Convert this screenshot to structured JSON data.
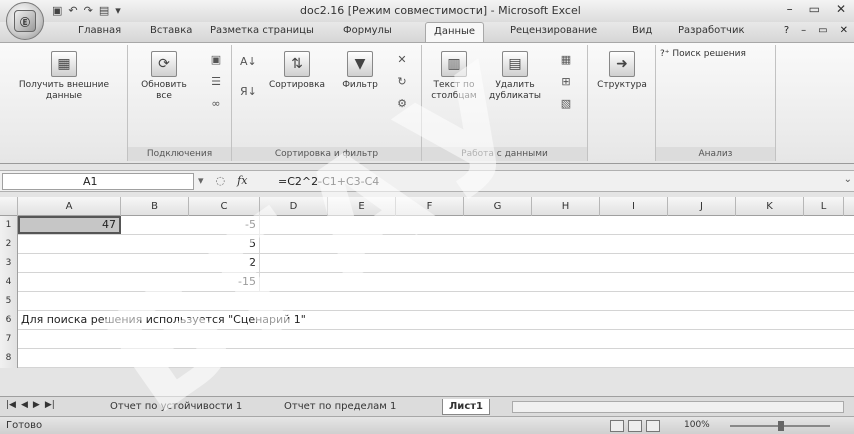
{
  "window": {
    "title": "doc2.16 [Режим совместимости] - Microsoft Excel",
    "office_logo": "Ⓔ"
  },
  "ribbon_tabs": [
    "Главная",
    "Вставка",
    "Разметка страницы",
    "Формулы",
    "Данные",
    "Рецензирование",
    "Вид",
    "Разработчик"
  ],
  "active_tab": "Данные",
  "ribbon": {
    "get_external": "Получить внешние данные",
    "refresh_all": "Обновить все",
    "group_connections": "Подключения",
    "sort": "Сортировка",
    "filter": "Фильтр",
    "group_sort_filter": "Сортировка и фильтр",
    "text_to_columns": "Текст по столбцам",
    "remove_duplicates": "Удалить дубликаты",
    "group_data_tools": "Работа с данными",
    "outline": "Структура",
    "solver": "Поиск решения",
    "group_analysis": "Анализ"
  },
  "formula_bar": {
    "name_box": "A1",
    "fx": "fx",
    "formula": "=C2^2-C1+C3-C4"
  },
  "columns": [
    "A",
    "B",
    "C",
    "D",
    "E",
    "F",
    "G",
    "H",
    "I",
    "J",
    "K",
    "L"
  ],
  "rows": [
    "1",
    "2",
    "3",
    "4",
    "5",
    "6",
    "7",
    "8"
  ],
  "cells": {
    "A1": "47",
    "C1": "-5",
    "C2": "5",
    "C3": "2",
    "C4": "-15",
    "A6": "Для поиска решения используется \"Сценарий 1\""
  },
  "sheets": [
    "Отчет по устойчивости 1",
    "Отчет по пределам 1",
    "Лист1"
  ],
  "active_sheet": "Лист1",
  "status": {
    "ready": "Готово",
    "zoom": "100%"
  },
  "watermark": "БГАУ"
}
